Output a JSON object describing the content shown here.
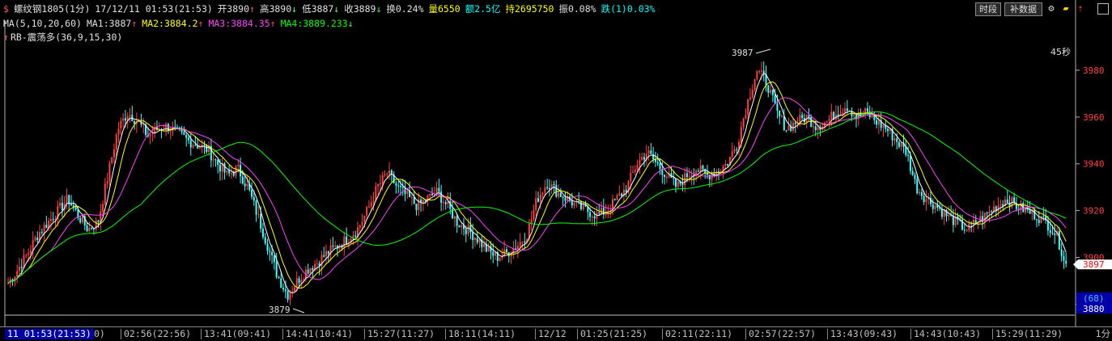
{
  "info": {
    "symbol": "螺纹钢1805(1分)",
    "datetime": "17/12/11 01:53(21:53)",
    "open": "开3890",
    "high": "高3890",
    "low": "低3887",
    "close": "收3889",
    "turnover": "换0.24%",
    "volume": "量6550",
    "amount": "额2.5亿",
    "open_interest": "持2695750",
    "amplitude": "振0.08%",
    "change": "跌(1)0.03%",
    "arrow_up": "↑",
    "arrow_down": "↓"
  },
  "ma": {
    "label": "MA(5,10,20,60)",
    "ma1": "MA1:3887",
    "ma2": "MA2:3884.2",
    "ma3": "MA3:3884.35",
    "ma4": "MA4:3889.233",
    "colors": {
      "ma1": "#ffffff",
      "ma2": "#ffff00",
      "ma3": "#ff40ff",
      "ma4": "#00ff00"
    }
  },
  "indicator": {
    "marker": "↑",
    "label": "RB-震荡多(36,9,15,30)"
  },
  "toolbar": {
    "timeshare": "时段",
    "fill_data": "补数据",
    "icons": [
      "gear-icon",
      "ruler-icon",
      "pin-icon"
    ]
  },
  "countdown": "45秒",
  "annotations": {
    "max": "3987",
    "min": "3879"
  },
  "current": {
    "price": "3897",
    "volume_label": "(68)",
    "bottom_price": "3880"
  },
  "time_axis": {
    "cursor": "11 01:53(21:53)",
    "first_partial": "0)",
    "ticks": [
      "02:56(22:56)",
      "13:41(09:41)",
      "14:41(10:41)",
      "15:27(11:27)",
      "18:11(14:11)",
      "12/12",
      "01:25(21:25)",
      "02:11(22:11)",
      "02:57(22:57)",
      "13:43(09:43)",
      "14:43(10:43)",
      "15:29(11:29)"
    ],
    "period": "1分"
  },
  "chart_data": {
    "type": "candlestick",
    "title": "",
    "y_ticks": [
      3880,
      3900,
      3920,
      3940,
      3960,
      3980
    ],
    "ylim": [
      3876,
      3990
    ],
    "y_tick_labels": [
      "3880",
      "3900",
      "3920",
      "3940",
      "3960",
      "3980"
    ],
    "x_categories": [
      "02:56(22:56)",
      "13:41(09:41)",
      "14:41(10:41)",
      "15:27(11:27)",
      "18:11(14:11)",
      "12/12",
      "01:25(21:25)",
      "02:11(22:11)",
      "02:57(22:57)",
      "13:43(09:43)",
      "14:43(10:43)",
      "15:29(11:29)"
    ],
    "close_path": [
      3889,
      3895,
      3902,
      3910,
      3915,
      3920,
      3925,
      3918,
      3912,
      3915,
      3935,
      3955,
      3962,
      3958,
      3952,
      3955,
      3956,
      3953,
      3950,
      3948,
      3946,
      3940,
      3935,
      3938,
      3930,
      3918,
      3905,
      3892,
      3884,
      3890,
      3895,
      3898,
      3902,
      3905,
      3908,
      3912,
      3920,
      3930,
      3936,
      3930,
      3926,
      3922,
      3925,
      3928,
      3922,
      3915,
      3912,
      3908,
      3903,
      3900,
      3902,
      3905,
      3910,
      3925,
      3932,
      3928,
      3925,
      3922,
      3920,
      3918,
      3920,
      3925,
      3930,
      3940,
      3945,
      3940,
      3935,
      3930,
      3935,
      3938,
      3935,
      3937,
      3940,
      3948,
      3965,
      3980,
      3975,
      3962,
      3955,
      3958,
      3960,
      3956,
      3958,
      3962,
      3965,
      3960,
      3962,
      3958,
      3955,
      3950,
      3945,
      3930,
      3925,
      3922,
      3918,
      3915,
      3912,
      3915,
      3918,
      3922,
      3925,
      3922,
      3920,
      3918,
      3915,
      3910,
      3897
    ],
    "series": [
      {
        "name": "MA1",
        "color": "#ffffff"
      },
      {
        "name": "MA2",
        "color": "#ffff00"
      },
      {
        "name": "MA3",
        "color": "#ff40ff"
      },
      {
        "name": "MA4",
        "color": "#00ff00"
      }
    ]
  }
}
